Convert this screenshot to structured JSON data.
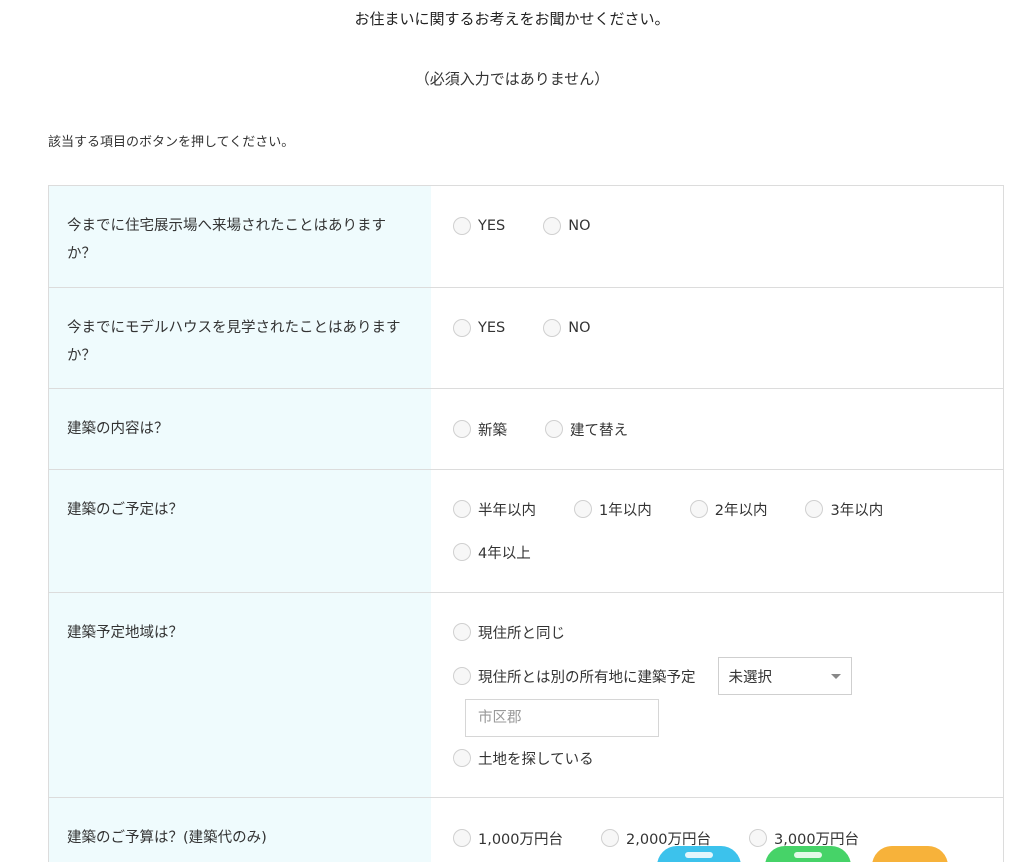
{
  "header": {
    "title": "お住まいに関するお考えをお聞かせください。",
    "subtitle": "（必須入力ではありません）",
    "instruction": "該当する項目のボタンを押してください。"
  },
  "questions": [
    {
      "label": "今までに住宅展示場へ来場されたことはありますか？",
      "options": [
        "YES",
        "NO"
      ]
    },
    {
      "label": "今までにモデルハウスを見学されたことはありますか？",
      "options": [
        "YES",
        "NO"
      ]
    },
    {
      "label": "建築の内容は？",
      "options": [
        "新築",
        "建て替え"
      ]
    },
    {
      "label": "建築のご予定は？",
      "options": [
        "半年以内",
        "1年以内",
        "2年以内",
        "3年以内",
        "4年以上"
      ]
    },
    {
      "label": "建築予定地域は？",
      "options": [
        "現住所と同じ",
        "現住所とは別の所有地に建築予定",
        "土地を探している"
      ],
      "select_value": "未選択",
      "input_placeholder": "市区郡"
    },
    {
      "label": "建築のご予算は？(建築代のみ)",
      "options": [
        "1,000万円台",
        "2,000万円台",
        "3,000万円台"
      ]
    }
  ],
  "floating_buttons": {
    "colors": {
      "blue": "#3cc2ec",
      "green": "#46d368",
      "orange": "#f7b23a"
    }
  }
}
